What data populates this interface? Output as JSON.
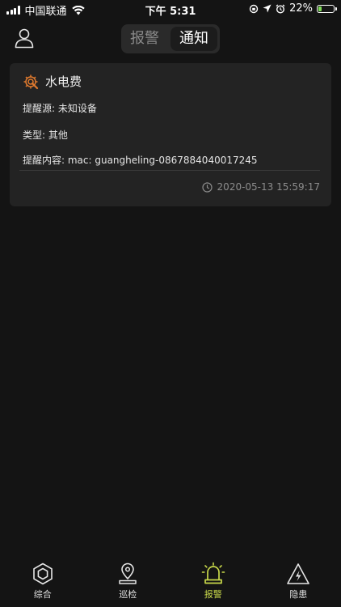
{
  "status": {
    "carrier": "中国联通",
    "time": "下午 5:31",
    "battery_percent": "22%",
    "battery_level": 0.22
  },
  "header": {
    "tabs": [
      {
        "label": "报警",
        "active": false
      },
      {
        "label": "通知",
        "active": true
      }
    ]
  },
  "notification": {
    "title": "水电费",
    "source_line": "提醒源: 未知设备",
    "type_line": "类型: 其他",
    "content_line": "提醒内容: mac: guangheling-0867884040017245",
    "timestamp": "2020-05-13 15:59:17"
  },
  "bottom_nav": {
    "items": [
      {
        "label": "综合",
        "icon": "hexagon-icon",
        "active": false
      },
      {
        "label": "巡检",
        "icon": "location-pin-icon",
        "active": false
      },
      {
        "label": "报警",
        "icon": "alarm-light-icon",
        "active": true
      },
      {
        "label": "隐患",
        "icon": "warning-bolt-icon",
        "active": false
      }
    ]
  },
  "colors": {
    "background": "#141414",
    "card": "#232323",
    "accent": "#c8d84a",
    "settings_icon": "#e07a2e"
  }
}
